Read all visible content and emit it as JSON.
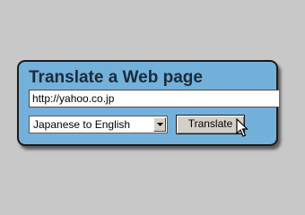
{
  "panel": {
    "title": "Translate a Web page"
  },
  "url_input": {
    "value": "http://yahoo.co.jp"
  },
  "language_select": {
    "selected": "Japanese to English"
  },
  "translate_button": {
    "label": "Translate"
  },
  "icons": {
    "dropdown_arrow": "triangle-down-icon",
    "cursor": "mouse-pointer-icon"
  },
  "colors": {
    "background": "#c8c8c8",
    "panel": "#74b1da",
    "title_text": "#1b2a3a",
    "button_face": "#d4d0c8"
  }
}
